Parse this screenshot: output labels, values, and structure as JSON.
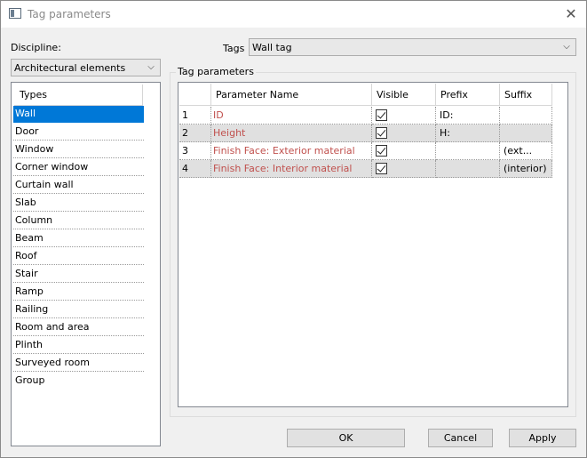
{
  "window": {
    "title": "Tag parameters",
    "close_glyph": "✕"
  },
  "discipline": {
    "label": "Discipline:",
    "value": "Architectural elements",
    "arrow": "⌵"
  },
  "tags": {
    "label": "Tags",
    "value": "Wall tag",
    "arrow": "⌵"
  },
  "types": {
    "header": "Types",
    "items": [
      "Wall",
      "Door",
      "Window",
      "Corner window",
      "Curtain wall",
      "Slab",
      "Column",
      "Beam",
      "Roof",
      "Stair",
      "Ramp",
      "Railing",
      "Room and area",
      "Plinth",
      "Surveyed room",
      "Group"
    ],
    "selected": "Wall"
  },
  "group_title": "Tag parameters",
  "table": {
    "headers": [
      "",
      "Parameter Name",
      "Visible",
      "Prefix",
      "Suffix"
    ],
    "rows": [
      {
        "num": "1",
        "name": "ID",
        "visible": true,
        "prefix": "ID:",
        "suffix": ""
      },
      {
        "num": "2",
        "name": "Height",
        "visible": true,
        "prefix": "H:",
        "suffix": ""
      },
      {
        "num": "3",
        "name": "Finish Face: Exterior material",
        "visible": true,
        "prefix": "",
        "suffix": "(ext..."
      },
      {
        "num": "4",
        "name": "Finish Face: Interior material",
        "visible": true,
        "prefix": "",
        "suffix": "(interior)"
      }
    ]
  },
  "buttons": {
    "ok": "OK",
    "cancel": "Cancel",
    "apply": "Apply"
  },
  "colors": {
    "selection": "#0078d7",
    "parameter_name": "#c0504d",
    "alt_row": "#e0e0e0"
  }
}
